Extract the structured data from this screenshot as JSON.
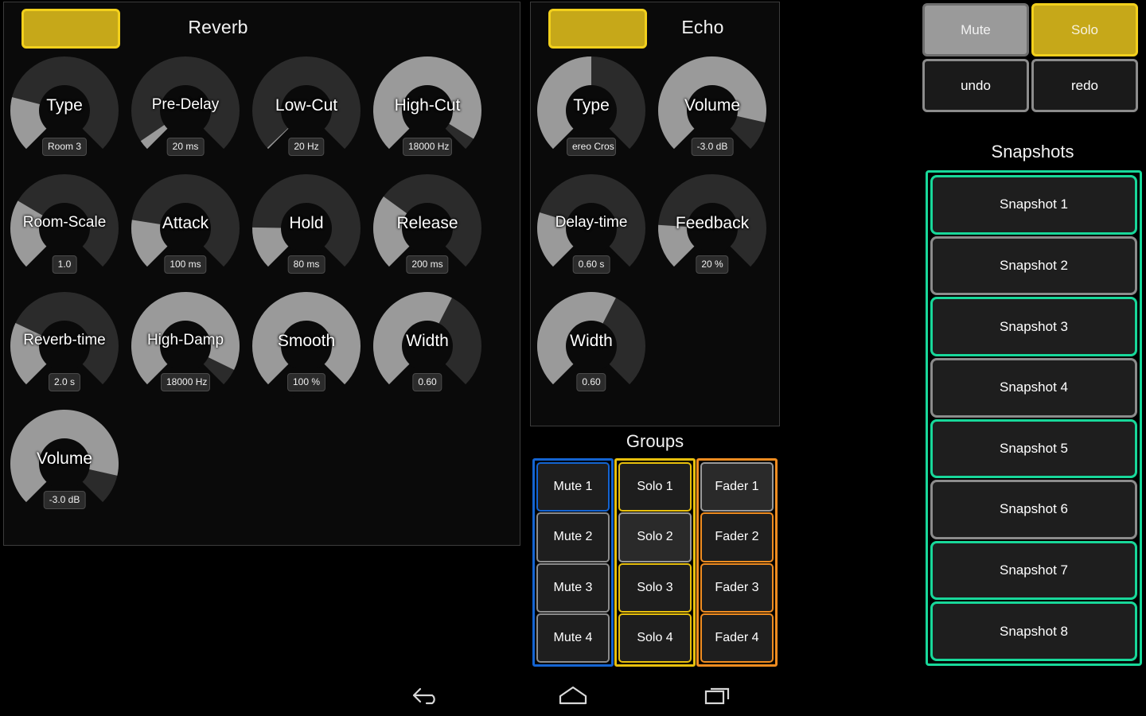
{
  "colors": {
    "accent_yellow": "#c6a819",
    "accent_yellow_border": "#f2d01c",
    "blue": "#1464d2",
    "orange": "#f08c20",
    "green": "#18d89a",
    "gray_border": "#8c8c8c",
    "panel_bg": "#0a0a0a",
    "knob_track": "#2b2b2b",
    "knob_fill": "#9a9a9a"
  },
  "reverb": {
    "title": "Reverb",
    "bypass_label": "",
    "knobs": [
      {
        "label": "Type",
        "value": "Room 3",
        "fraction": 0.22
      },
      {
        "label": "Pre-Delay",
        "value": "20 ms",
        "fraction": 0.04
      },
      {
        "label": "Low-Cut",
        "value": "20 Hz",
        "fraction": 0.005
      },
      {
        "label": "High-Cut",
        "value": "18000 Hz",
        "fraction": 0.95
      },
      {
        "label": "Room-Scale",
        "value": "1.0",
        "fraction": 0.28
      },
      {
        "label": "Attack",
        "value": "100 ms",
        "fraction": 0.2
      },
      {
        "label": "Hold",
        "value": "80 ms",
        "fraction": 0.17
      },
      {
        "label": "Release",
        "value": "200 ms",
        "fraction": 0.3
      },
      {
        "label": "Reverb-time",
        "value": "2.0 s",
        "fraction": 0.26
      },
      {
        "label": "High-Damp",
        "value": "18000 Hz",
        "fraction": 0.93
      },
      {
        "label": "Smooth",
        "value": "100 %",
        "fraction": 1.0
      },
      {
        "label": "Width",
        "value": "0.60",
        "fraction": 0.6
      },
      {
        "label": "Volume",
        "value": "-3.0 dB",
        "fraction": 0.88
      }
    ]
  },
  "echo": {
    "title": "Echo",
    "bypass_label": "",
    "knobs": [
      {
        "label": "Type",
        "value": "ereo Cros",
        "fraction": 0.5
      },
      {
        "label": "Volume",
        "value": "-3.0 dB",
        "fraction": 0.88
      },
      {
        "label": "Delay-time",
        "value": "0.60 s",
        "fraction": 0.23
      },
      {
        "label": "Feedback",
        "value": "20 %",
        "fraction": 0.18
      },
      {
        "label": "Width",
        "value": "0.60",
        "fraction": 0.6
      }
    ]
  },
  "groups": {
    "title": "Groups",
    "columns": [
      {
        "name": "mute",
        "accent": "blue",
        "buttons": [
          {
            "label": "Mute 1",
            "selected": true,
            "state": "sel-blue"
          },
          {
            "label": "Mute 2",
            "selected": false,
            "state": ""
          },
          {
            "label": "Mute 3",
            "selected": false,
            "state": ""
          },
          {
            "label": "Mute 4",
            "selected": false,
            "state": ""
          }
        ]
      },
      {
        "name": "solo",
        "accent": "yellow",
        "buttons": [
          {
            "label": "Solo 1",
            "selected": true,
            "state": "sel-yellow"
          },
          {
            "label": "Solo 2",
            "selected": false,
            "state": "sel-gray"
          },
          {
            "label": "Solo 3",
            "selected": true,
            "state": "sel-yellow"
          },
          {
            "label": "Solo 4",
            "selected": true,
            "state": "sel-yellow"
          }
        ]
      },
      {
        "name": "fader",
        "accent": "orange",
        "buttons": [
          {
            "label": "Fader 1",
            "selected": false,
            "state": "sel-gray"
          },
          {
            "label": "Fader 2",
            "selected": true,
            "state": "sel-orange"
          },
          {
            "label": "Fader 3",
            "selected": true,
            "state": "sel-orange"
          },
          {
            "label": "Fader 4",
            "selected": true,
            "state": "sel-orange"
          }
        ]
      }
    ]
  },
  "right_panel": {
    "mute_label": "Mute",
    "solo_label": "Solo",
    "undo_label": "undo",
    "redo_label": "redo",
    "snapshots_title": "Snapshots",
    "snapshots": [
      {
        "label": "Snapshot 1",
        "selected": true
      },
      {
        "label": "Snapshot 2",
        "selected": false
      },
      {
        "label": "Snapshot 3",
        "selected": true
      },
      {
        "label": "Snapshot 4",
        "selected": false
      },
      {
        "label": "Snapshot 5",
        "selected": true
      },
      {
        "label": "Snapshot 6",
        "selected": false
      },
      {
        "label": "Snapshot 7",
        "selected": true
      },
      {
        "label": "Snapshot 8",
        "selected": true
      }
    ]
  },
  "navbar": {
    "back": "back-icon",
    "home": "home-icon",
    "recents": "recents-icon"
  }
}
